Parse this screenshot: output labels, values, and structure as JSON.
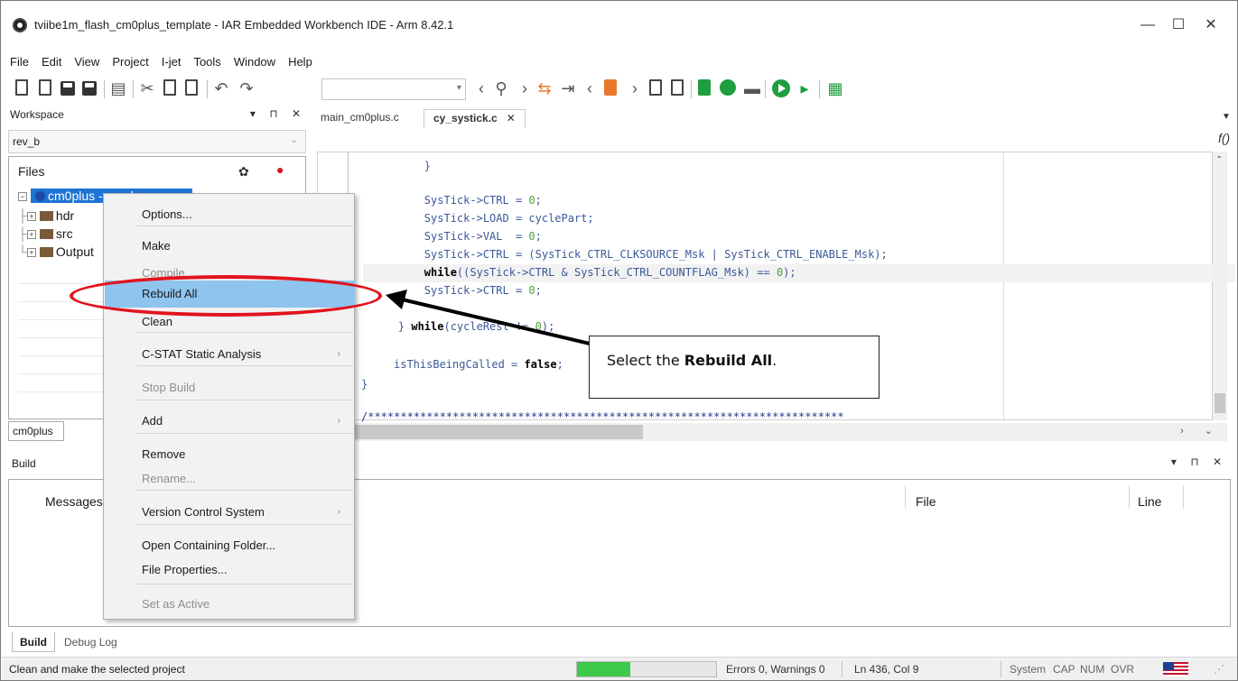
{
  "window": {
    "title": "tviibe1m_flash_cm0plus_template - IAR Embedded Workbench IDE - Arm 8.42.1",
    "minimize": "—",
    "maximize": "☐",
    "close": "✕"
  },
  "menu": [
    "File",
    "Edit",
    "View",
    "Project",
    "I-jet",
    "Tools",
    "Window",
    "Help"
  ],
  "workspace": {
    "title": "Workspace",
    "controls": "▾ ⊓ ✕",
    "config": "rev_b",
    "files_header": "Files",
    "project_label": "cm0plus - rev_b",
    "folders": [
      "hdr",
      "src",
      "Output"
    ],
    "tab": "cm0plus"
  },
  "editor": {
    "tabs": [
      "main_cm0plus.c",
      "cy_systick.c"
    ],
    "active_tab": "cy_systick.c",
    "close_glyph": "✕",
    "fx_label": "f()",
    "code_lines": [
      "        }",
      "",
      "        SysTick->CTRL = 0;",
      "        SysTick->LOAD = cyclePart;",
      "        SysTick->VAL  = 0;",
      "        SysTick->CTRL = (SysTick_CTRL_CLKSOURCE_Msk | SysTick_CTRL_ENABLE_Msk);",
      "        while((SysTick->CTRL & SysTick_CTRL_COUNTFLAG_Msk) == 0);",
      "        SysTick->CTRL = 0;",
      "",
      "    } while(cycleRest != 0);",
      "",
      "  isThisBeingCalled = false;",
      "}",
      "",
      "/*****************************************************************************"
    ]
  },
  "build": {
    "title": "Build",
    "controls": "▾ ⊓ ✕",
    "columns": {
      "messages": "Messages",
      "file": "File",
      "line": "Line"
    },
    "tabs": [
      "Build",
      "Debug Log"
    ]
  },
  "context_menu": {
    "items": [
      {
        "label": "Options...",
        "enabled": true
      },
      {
        "label": "Make",
        "enabled": true
      },
      {
        "label": "Compile",
        "enabled": false
      },
      {
        "label": "Rebuild All",
        "enabled": true,
        "highlighted": true
      },
      {
        "label": "Clean",
        "enabled": true
      },
      {
        "label": "C-STAT Static Analysis",
        "enabled": true,
        "submenu": true
      },
      {
        "label": "Stop Build",
        "enabled": false
      },
      {
        "label": "Add",
        "enabled": true,
        "submenu": true
      },
      {
        "label": "Remove",
        "enabled": true
      },
      {
        "label": "Rename...",
        "enabled": false
      },
      {
        "label": "Version Control System",
        "enabled": true,
        "submenu": true
      },
      {
        "label": "Open Containing Folder...",
        "enabled": true
      },
      {
        "label": "File Properties...",
        "enabled": true
      },
      {
        "label": "Set as Active",
        "enabled": false
      }
    ]
  },
  "status": {
    "message": "Clean and make the selected project",
    "progress_fraction": 0.38,
    "errors": "Errors 0, Warnings 0",
    "position": "Ln 436, Col 9",
    "system": "System",
    "cap": "CAP",
    "num": "NUM",
    "ovr": "OVR"
  },
  "annotation": {
    "prefix": "Select the ",
    "bold": "Rebuild All",
    "suffix": "."
  },
  "colors": {
    "selection": "#1e74d4",
    "menu_highlight": "#8ec4ee",
    "annotation_red": "#e1141e",
    "progress_green": "#3ec84c"
  }
}
